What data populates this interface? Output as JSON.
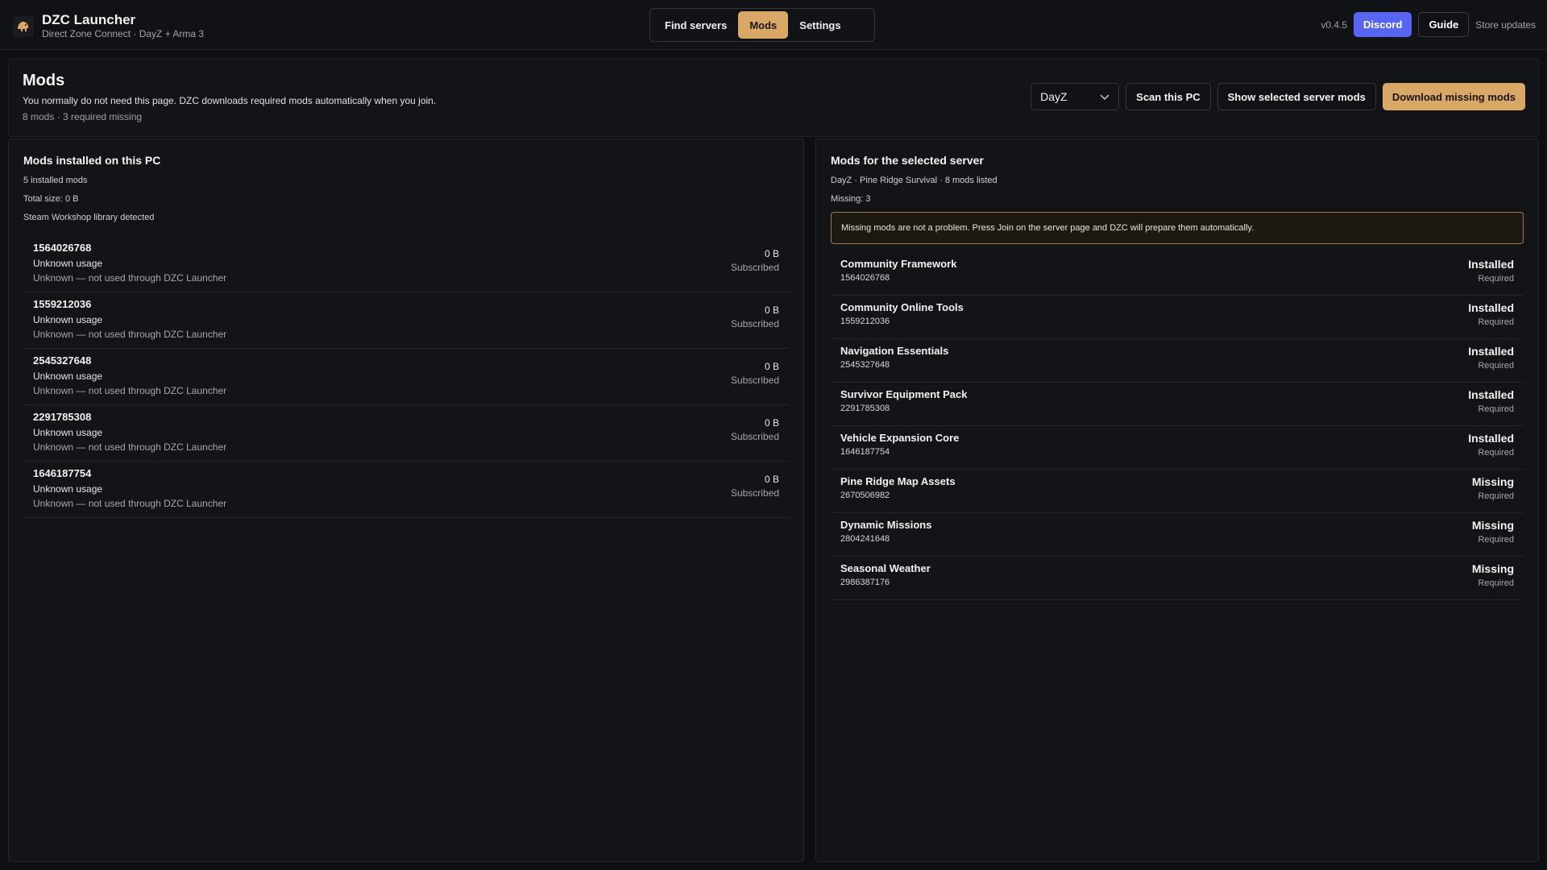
{
  "app": {
    "title": "DZC Launcher",
    "subtitle": "Direct Zone Connect · DayZ + Arma 3",
    "version": "v0.4.5",
    "discord_label": "Discord",
    "guide_label": "Guide",
    "store_updates_label": "Store updates",
    "accent_color": "#d9a866",
    "discord_color": "#5865f2"
  },
  "nav": {
    "tabs": [
      {
        "label": "Find servers",
        "active": false
      },
      {
        "label": "Mods",
        "active": true
      },
      {
        "label": "Settings",
        "active": false
      }
    ]
  },
  "header": {
    "title": "Mods",
    "description": "You normally do not need this page. DZC downloads required mods automatically when you join.",
    "meta": "8 mods · 3 required missing",
    "game_select": "DayZ",
    "scan_label": "Scan this PC",
    "show_server_mods_label": "Show selected server mods",
    "download_missing_label": "Download missing mods"
  },
  "installed": {
    "title": "Mods installed on this PC",
    "count": "5 installed mods",
    "total_size": "Total size: 0 B",
    "library_status": "Steam Workshop library detected",
    "items": [
      {
        "id": "1564026768",
        "usage": "Unknown usage",
        "note": "Unknown — not used through DZC Launcher",
        "size": "0 B",
        "state": "Subscribed"
      },
      {
        "id": "1559212036",
        "usage": "Unknown usage",
        "note": "Unknown — not used through DZC Launcher",
        "size": "0 B",
        "state": "Subscribed"
      },
      {
        "id": "2545327648",
        "usage": "Unknown usage",
        "note": "Unknown — not used through DZC Launcher",
        "size": "0 B",
        "state": "Subscribed"
      },
      {
        "id": "2291785308",
        "usage": "Unknown usage",
        "note": "Unknown — not used through DZC Launcher",
        "size": "0 B",
        "state": "Subscribed"
      },
      {
        "id": "1646187754",
        "usage": "Unknown usage",
        "note": "Unknown — not used through DZC Launcher",
        "size": "0 B",
        "state": "Subscribed"
      }
    ]
  },
  "server_mods": {
    "title": "Mods for the selected server",
    "summary": "DayZ · Pine Ridge Survival · 8 mods listed",
    "missing": "Missing: 3",
    "notice": "Missing mods are not a problem. Press Join on the server page and DZC will prepare them automatically.",
    "items": [
      {
        "name": "Community Framework",
        "id": "1564026768",
        "status": "Installed",
        "requirement": "Required"
      },
      {
        "name": "Community Online Tools",
        "id": "1559212036",
        "status": "Installed",
        "requirement": "Required"
      },
      {
        "name": "Navigation Essentials",
        "id": "2545327648",
        "status": "Installed",
        "requirement": "Required"
      },
      {
        "name": "Survivor Equipment Pack",
        "id": "2291785308",
        "status": "Installed",
        "requirement": "Required"
      },
      {
        "name": "Vehicle Expansion Core",
        "id": "1646187754",
        "status": "Installed",
        "requirement": "Required"
      },
      {
        "name": "Pine Ridge Map Assets",
        "id": "2670506982",
        "status": "Missing",
        "requirement": "Required"
      },
      {
        "name": "Dynamic Missions",
        "id": "2804241648",
        "status": "Missing",
        "requirement": "Required"
      },
      {
        "name": "Seasonal Weather",
        "id": "2986387176",
        "status": "Missing",
        "requirement": "Required"
      }
    ]
  }
}
